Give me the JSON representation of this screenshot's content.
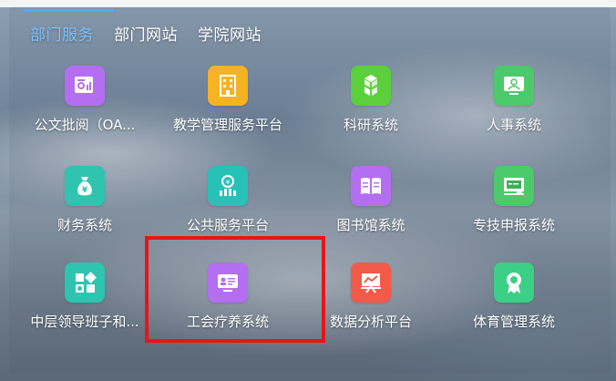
{
  "tabs": [
    {
      "label": "部门服务",
      "active": true
    },
    {
      "label": "部门网站",
      "active": false
    },
    {
      "label": "学院网站",
      "active": false
    }
  ],
  "apps": [
    {
      "label": "公文批阅（OA...",
      "icon": "document-chart-icon",
      "color": "#b46ef0"
    },
    {
      "label": "教学管理服务平台",
      "icon": "building-icon",
      "color": "#f5b324"
    },
    {
      "label": "科研系统",
      "icon": "cubes-icon",
      "color": "#5ccf3d"
    },
    {
      "label": "人事系统",
      "icon": "person-monitor-icon",
      "color": "#4cc96a"
    },
    {
      "label": "财务系统",
      "icon": "money-bag-icon",
      "color": "#2ec4b0"
    },
    {
      "label": "公共服务平台",
      "icon": "yen-coin-icon",
      "color": "#28c1b6"
    },
    {
      "label": "图书馆系统",
      "icon": "open-book-icon",
      "color": "#b46ef0"
    },
    {
      "label": "专技申报系统",
      "icon": "blackboard-icon",
      "color": "#4cc96a"
    },
    {
      "label": "中层领导班子和...",
      "icon": "apps-grid-icon",
      "color": "#2ec4b0"
    },
    {
      "label": "工会疗养系统",
      "icon": "id-card-monitor-icon",
      "color": "#b46ef0"
    },
    {
      "label": "数据分析平台",
      "icon": "chart-board-icon",
      "color": "#f25a4a"
    },
    {
      "label": "体育管理系统",
      "icon": "award-ribbon-icon",
      "color": "#3ccf86"
    }
  ]
}
